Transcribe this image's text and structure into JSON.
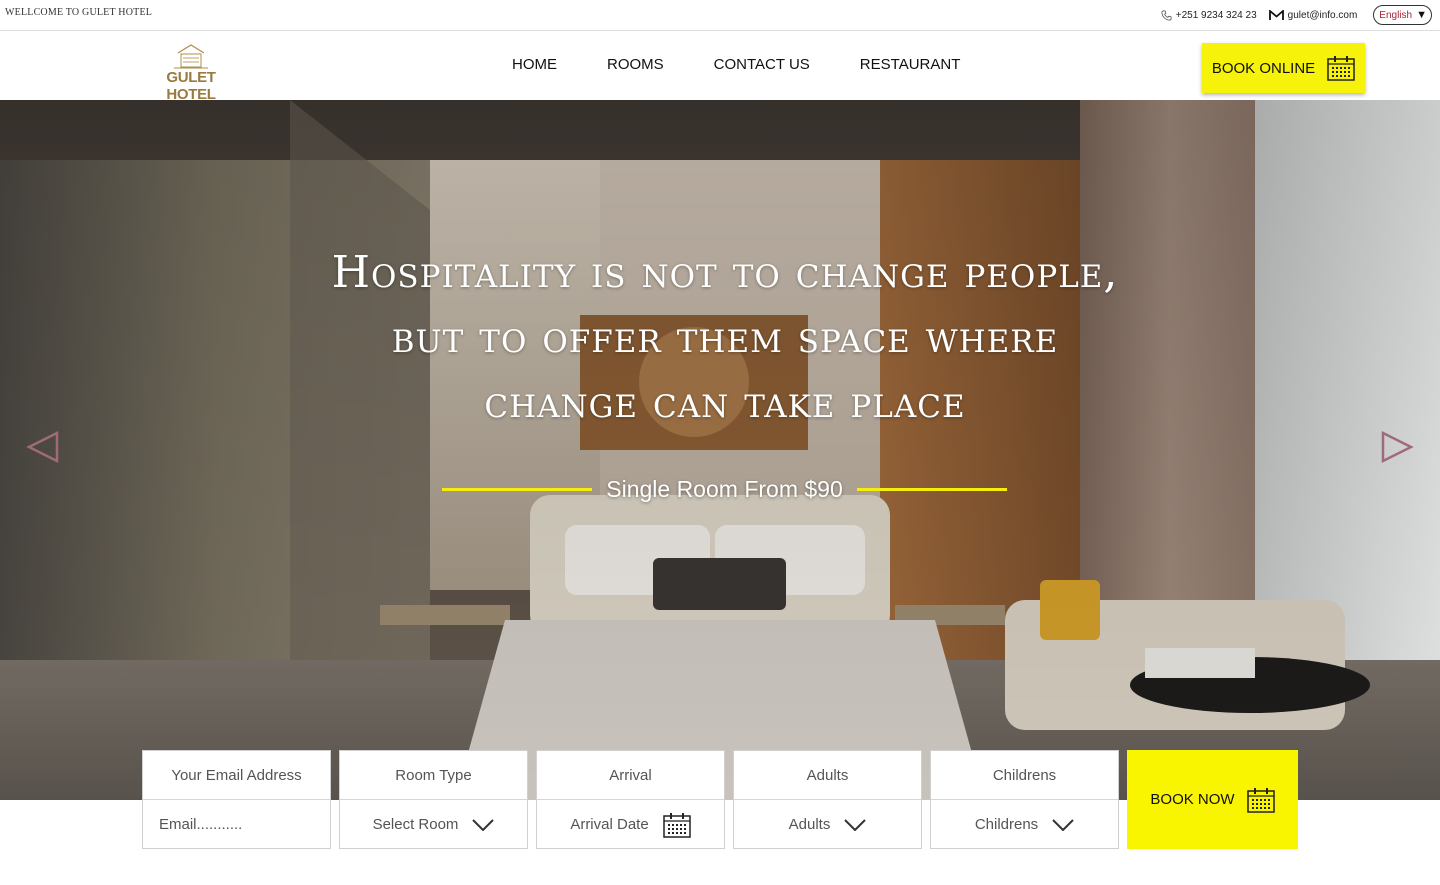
{
  "topbar": {
    "welcome": "WELLCOME TO GULET HOTEL",
    "phone": "+251 9234 324 23",
    "email": "gulet@info.com",
    "language": "English"
  },
  "header": {
    "logo_text": "GULET HOTEL",
    "nav": [
      "HOME",
      "ROOMS",
      "CONTACT US",
      "RESTAURANT"
    ],
    "book_online": "BOOK ONLINE"
  },
  "hero": {
    "quote_lines": [
      "Hospitality is not to change people,",
      "but to offer them space where",
      "change can take place"
    ],
    "price_text": "Single Room From $90"
  },
  "booking": {
    "email": {
      "label": "Your Email Address",
      "placeholder": "Email..........."
    },
    "room_type": {
      "label": "Room Type",
      "value": "Select Room"
    },
    "arrival": {
      "label": "Arrival",
      "value": "Arrival Date"
    },
    "adults": {
      "label": "Adults",
      "value": "Adults"
    },
    "childrens": {
      "label": "Childrens",
      "value": "Childrens"
    },
    "book_now": "BOOK NOW"
  },
  "colors": {
    "accent": "#f7f20a",
    "logo_gold": "#9a7b3e"
  },
  "icons": [
    "phone-icon",
    "mail-icon",
    "dropdown-triangle-icon",
    "calendar-icon",
    "chevron-down-icon",
    "arrow-left-icon",
    "arrow-right-icon"
  ]
}
